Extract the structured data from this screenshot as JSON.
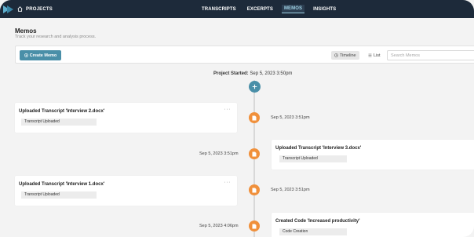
{
  "nav": {
    "projects_label": "PROJECTS",
    "tabs": [
      {
        "label": "TRANSCRIPTS",
        "active": false
      },
      {
        "label": "EXCERPTS",
        "active": false
      },
      {
        "label": "MEMOS",
        "active": true
      },
      {
        "label": "INSIGHTS",
        "active": false
      }
    ]
  },
  "page": {
    "title": "Memos",
    "subtitle": "Track your research and analysis process."
  },
  "toolbar": {
    "create_label": "Create Memo",
    "timeline_label": "Timeline",
    "list_label": "List",
    "search_placeholder": "Search Memos"
  },
  "timeline": {
    "started_label": "Project Started:",
    "started_time": "Sep 5, 2023 3:50pm",
    "entries": [
      {
        "side": "left",
        "title": "Uploaded Transcript 'Interview 2.docx'",
        "tag": "Transcript Uploaded",
        "time": "Sep 5, 2023 3:51pm",
        "more": "···"
      },
      {
        "side": "right",
        "title": "Uploaded Transcript 'Interview 3.docx'",
        "tag": "Transcript Uploaded",
        "time": "Sep 5, 2023 3:51pm"
      },
      {
        "side": "left",
        "title": "Uploaded Transcript 'Interview 1.docx'",
        "tag": "Transcript Uploaded",
        "time": "Sep 5, 2023 3:51pm",
        "more": "···"
      },
      {
        "side": "right",
        "title": "Created Code 'Increased productivity'",
        "tag": "Code Creation",
        "time": "Sep 5, 2023 4:06pm"
      }
    ]
  },
  "colors": {
    "nav_bg": "#1d2a3a",
    "accent": "#4a8fa8",
    "node": "#f0903b"
  }
}
